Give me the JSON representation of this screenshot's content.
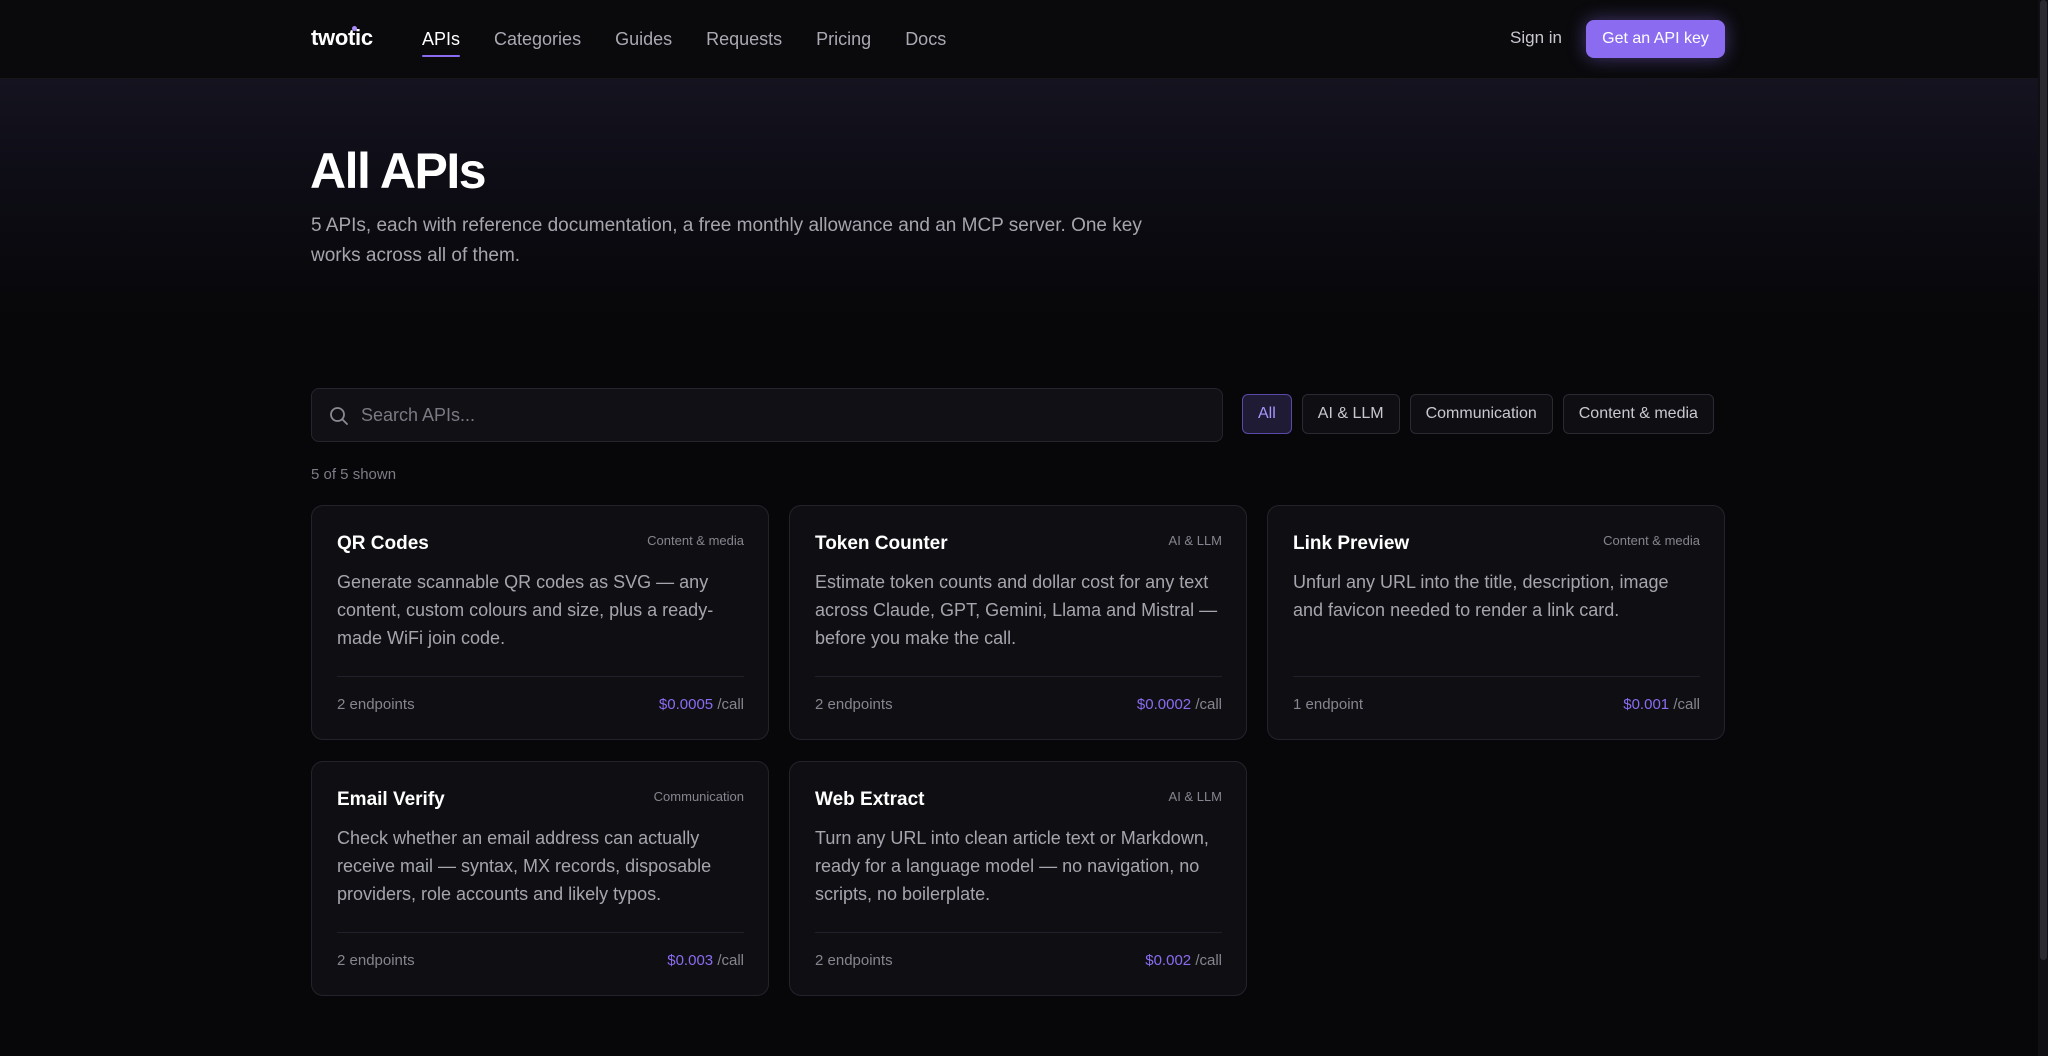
{
  "brand": {
    "name": "twotic",
    "accent": "#8b6cf0",
    "background": "#070709"
  },
  "nav": {
    "items": [
      {
        "label": "APIs",
        "active": true
      },
      {
        "label": "Categories",
        "active": false
      },
      {
        "label": "Guides",
        "active": false
      },
      {
        "label": "Requests",
        "active": false
      },
      {
        "label": "Pricing",
        "active": false
      },
      {
        "label": "Docs",
        "active": false
      }
    ],
    "signin": "Sign in",
    "cta": "Get an API key"
  },
  "hero": {
    "title": "All APIs",
    "subtitle": "5 APIs, each with reference documentation, a free monthly allowance and an MCP server. One key works across all of them."
  },
  "search": {
    "placeholder": "Search APIs...",
    "value": "",
    "icon": "search-icon"
  },
  "filters": [
    {
      "label": "All",
      "active": true
    },
    {
      "label": "AI & LLM",
      "active": false
    },
    {
      "label": "Communication",
      "active": false
    },
    {
      "label": "Content & media",
      "active": false
    }
  ],
  "results": {
    "count_text": "5 of 5 shown"
  },
  "cards": [
    {
      "name": "QR Codes",
      "category": "Content & media",
      "description": "Generate scannable QR codes as SVG — any content, custom colours and size, plus a ready-made WiFi join code.",
      "endpoints": "2 endpoints",
      "price": "$0.0005",
      "unit": "/call"
    },
    {
      "name": "Token Counter",
      "category": "AI & LLM",
      "description": "Estimate token counts and dollar cost for any text across Claude, GPT, Gemini, Llama and Mistral — before you make the call.",
      "endpoints": "2 endpoints",
      "price": "$0.0002",
      "unit": "/call"
    },
    {
      "name": "Link Preview",
      "category": "Content & media",
      "description": "Unfurl any URL into the title, description, image and favicon needed to render a link card.",
      "endpoints": "1 endpoint",
      "price": "$0.001",
      "unit": "/call"
    },
    {
      "name": "Email Verify",
      "category": "Communication",
      "description": "Check whether an email address can actually receive mail — syntax, MX records, disposable providers, role accounts and likely typos.",
      "endpoints": "2 endpoints",
      "price": "$0.003",
      "unit": "/call"
    },
    {
      "name": "Web Extract",
      "category": "AI & LLM",
      "description": "Turn any URL into clean article text or Markdown, ready for a language model — no navigation, no scripts, no boilerplate.",
      "endpoints": "2 endpoints",
      "price": "$0.002",
      "unit": "/call"
    }
  ]
}
